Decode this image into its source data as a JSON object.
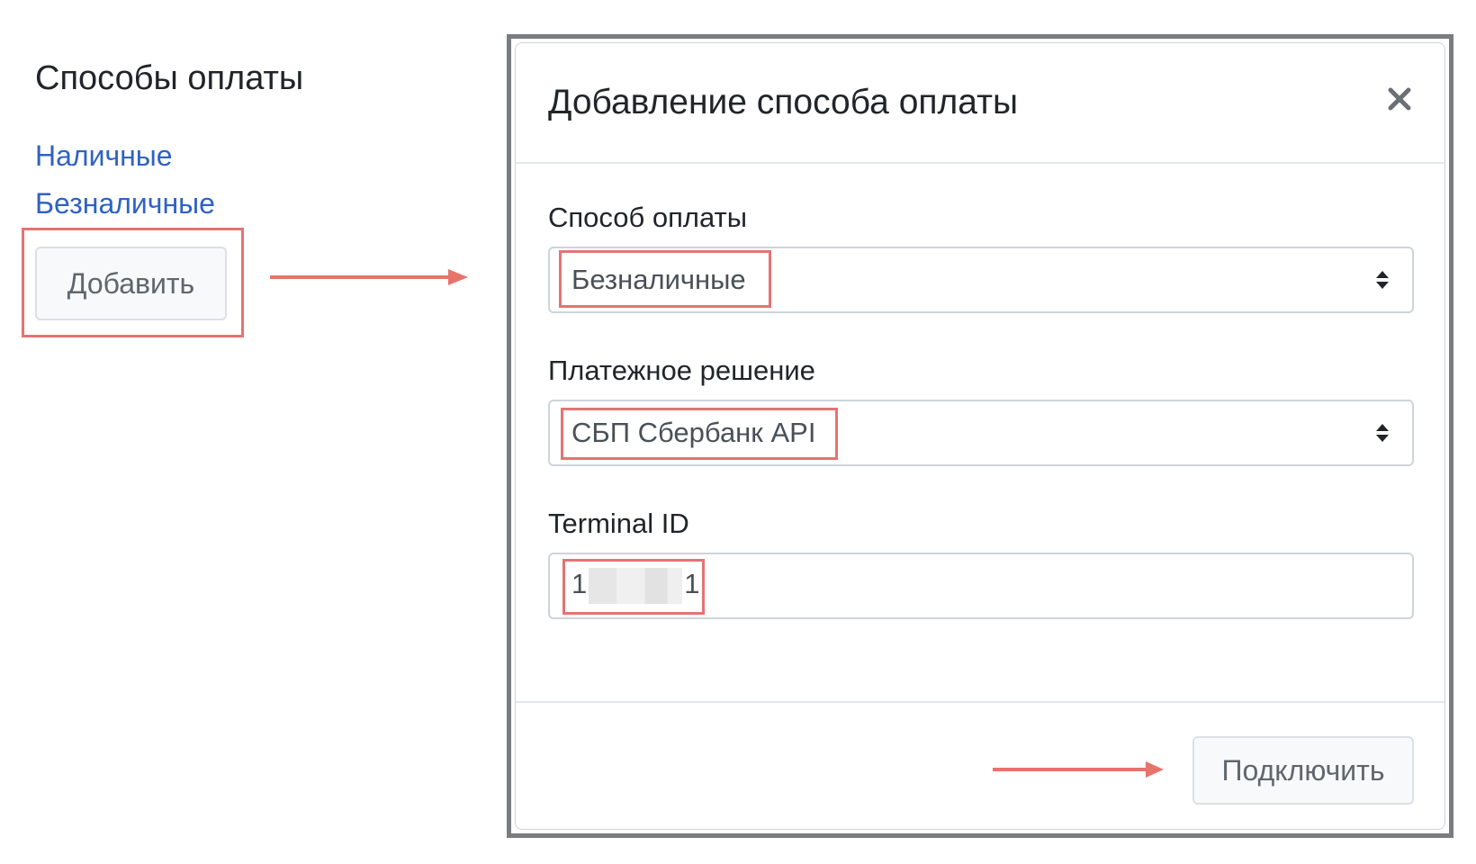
{
  "page": {
    "title": "Способы оплаты",
    "methods": [
      "Наличные",
      "Безналичные"
    ],
    "add_label": "Добавить"
  },
  "modal": {
    "title": "Добавление способа оплаты",
    "close_label": "×",
    "fields": {
      "payment_method": {
        "label": "Способ оплаты",
        "value": "Безналичные"
      },
      "payment_solution": {
        "label": "Платежное решение",
        "value": "СБП Сбербанк API"
      },
      "terminal_id": {
        "label": "Terminal ID",
        "value_prefix": "1",
        "value_suffix": "1"
      }
    },
    "submit_label": "Подключить"
  },
  "colors": {
    "link": "#2f62c4",
    "highlight": "#e57373",
    "arrow": "#e8736b",
    "frame": "#7a7c80"
  },
  "icons": {
    "close": "close-icon",
    "select": "select-caret-icon",
    "arrow": "arrow-right-icon"
  }
}
